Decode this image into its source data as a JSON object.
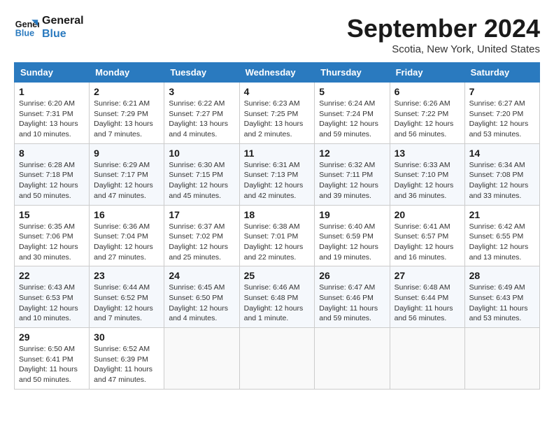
{
  "header": {
    "logo_text_general": "General",
    "logo_text_blue": "Blue",
    "month_title": "September 2024",
    "location": "Scotia, New York, United States"
  },
  "days_of_week": [
    "Sunday",
    "Monday",
    "Tuesday",
    "Wednesday",
    "Thursday",
    "Friday",
    "Saturday"
  ],
  "weeks": [
    [
      {
        "day": "1",
        "info": "Sunrise: 6:20 AM\nSunset: 7:31 PM\nDaylight: 13 hours\nand 10 minutes."
      },
      {
        "day": "2",
        "info": "Sunrise: 6:21 AM\nSunset: 7:29 PM\nDaylight: 13 hours\nand 7 minutes."
      },
      {
        "day": "3",
        "info": "Sunrise: 6:22 AM\nSunset: 7:27 PM\nDaylight: 13 hours\nand 4 minutes."
      },
      {
        "day": "4",
        "info": "Sunrise: 6:23 AM\nSunset: 7:25 PM\nDaylight: 13 hours\nand 2 minutes."
      },
      {
        "day": "5",
        "info": "Sunrise: 6:24 AM\nSunset: 7:24 PM\nDaylight: 12 hours\nand 59 minutes."
      },
      {
        "day": "6",
        "info": "Sunrise: 6:26 AM\nSunset: 7:22 PM\nDaylight: 12 hours\nand 56 minutes."
      },
      {
        "day": "7",
        "info": "Sunrise: 6:27 AM\nSunset: 7:20 PM\nDaylight: 12 hours\nand 53 minutes."
      }
    ],
    [
      {
        "day": "8",
        "info": "Sunrise: 6:28 AM\nSunset: 7:18 PM\nDaylight: 12 hours\nand 50 minutes."
      },
      {
        "day": "9",
        "info": "Sunrise: 6:29 AM\nSunset: 7:17 PM\nDaylight: 12 hours\nand 47 minutes."
      },
      {
        "day": "10",
        "info": "Sunrise: 6:30 AM\nSunset: 7:15 PM\nDaylight: 12 hours\nand 45 minutes."
      },
      {
        "day": "11",
        "info": "Sunrise: 6:31 AM\nSunset: 7:13 PM\nDaylight: 12 hours\nand 42 minutes."
      },
      {
        "day": "12",
        "info": "Sunrise: 6:32 AM\nSunset: 7:11 PM\nDaylight: 12 hours\nand 39 minutes."
      },
      {
        "day": "13",
        "info": "Sunrise: 6:33 AM\nSunset: 7:10 PM\nDaylight: 12 hours\nand 36 minutes."
      },
      {
        "day": "14",
        "info": "Sunrise: 6:34 AM\nSunset: 7:08 PM\nDaylight: 12 hours\nand 33 minutes."
      }
    ],
    [
      {
        "day": "15",
        "info": "Sunrise: 6:35 AM\nSunset: 7:06 PM\nDaylight: 12 hours\nand 30 minutes."
      },
      {
        "day": "16",
        "info": "Sunrise: 6:36 AM\nSunset: 7:04 PM\nDaylight: 12 hours\nand 27 minutes."
      },
      {
        "day": "17",
        "info": "Sunrise: 6:37 AM\nSunset: 7:02 PM\nDaylight: 12 hours\nand 25 minutes."
      },
      {
        "day": "18",
        "info": "Sunrise: 6:38 AM\nSunset: 7:01 PM\nDaylight: 12 hours\nand 22 minutes."
      },
      {
        "day": "19",
        "info": "Sunrise: 6:40 AM\nSunset: 6:59 PM\nDaylight: 12 hours\nand 19 minutes."
      },
      {
        "day": "20",
        "info": "Sunrise: 6:41 AM\nSunset: 6:57 PM\nDaylight: 12 hours\nand 16 minutes."
      },
      {
        "day": "21",
        "info": "Sunrise: 6:42 AM\nSunset: 6:55 PM\nDaylight: 12 hours\nand 13 minutes."
      }
    ],
    [
      {
        "day": "22",
        "info": "Sunrise: 6:43 AM\nSunset: 6:53 PM\nDaylight: 12 hours\nand 10 minutes."
      },
      {
        "day": "23",
        "info": "Sunrise: 6:44 AM\nSunset: 6:52 PM\nDaylight: 12 hours\nand 7 minutes."
      },
      {
        "day": "24",
        "info": "Sunrise: 6:45 AM\nSunset: 6:50 PM\nDaylight: 12 hours\nand 4 minutes."
      },
      {
        "day": "25",
        "info": "Sunrise: 6:46 AM\nSunset: 6:48 PM\nDaylight: 12 hours\nand 1 minute."
      },
      {
        "day": "26",
        "info": "Sunrise: 6:47 AM\nSunset: 6:46 PM\nDaylight: 11 hours\nand 59 minutes."
      },
      {
        "day": "27",
        "info": "Sunrise: 6:48 AM\nSunset: 6:44 PM\nDaylight: 11 hours\nand 56 minutes."
      },
      {
        "day": "28",
        "info": "Sunrise: 6:49 AM\nSunset: 6:43 PM\nDaylight: 11 hours\nand 53 minutes."
      }
    ],
    [
      {
        "day": "29",
        "info": "Sunrise: 6:50 AM\nSunset: 6:41 PM\nDaylight: 11 hours\nand 50 minutes."
      },
      {
        "day": "30",
        "info": "Sunrise: 6:52 AM\nSunset: 6:39 PM\nDaylight: 11 hours\nand 47 minutes."
      },
      {
        "day": "",
        "info": ""
      },
      {
        "day": "",
        "info": ""
      },
      {
        "day": "",
        "info": ""
      },
      {
        "day": "",
        "info": ""
      },
      {
        "day": "",
        "info": ""
      }
    ]
  ]
}
